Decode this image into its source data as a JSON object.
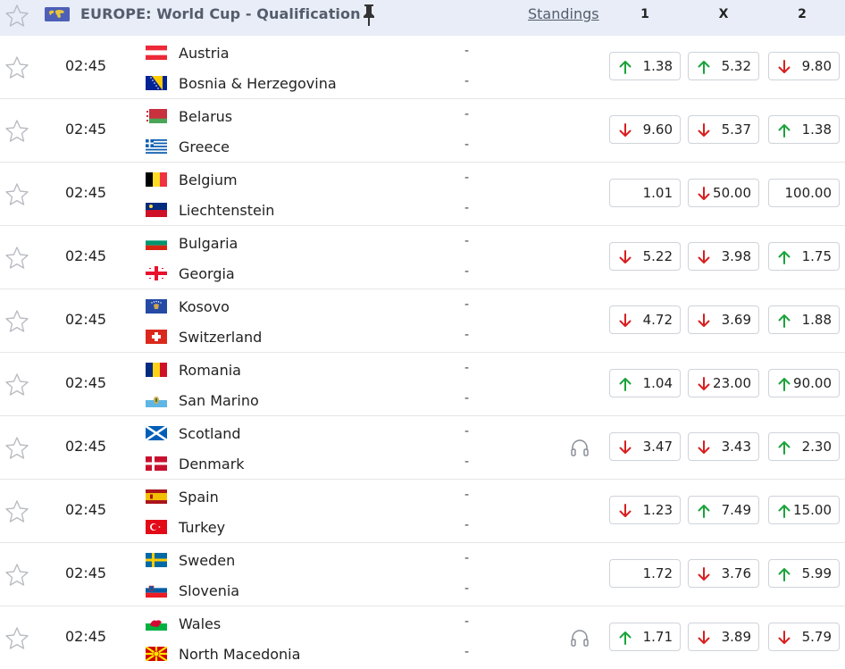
{
  "header": {
    "title": "EUROPE: World Cup - Qualification",
    "standings_label": "Standings",
    "col_1": "1",
    "col_x": "X",
    "col_2": "2"
  },
  "colors": {
    "up": "#1aa33a",
    "down": "#d81f1f",
    "header_bg": "#e8edf7"
  },
  "matches": [
    {
      "time": "02:45",
      "home": "Austria",
      "away": "Bosnia & Herzegovina",
      "home_score": "-",
      "away_score": "-",
      "audio": false,
      "odds": [
        {
          "value": "1.38",
          "dir": "up"
        },
        {
          "value": "5.32",
          "dir": "up"
        },
        {
          "value": "9.80",
          "dir": "down"
        }
      ]
    },
    {
      "time": "02:45",
      "home": "Belarus",
      "away": "Greece",
      "home_score": "-",
      "away_score": "-",
      "audio": false,
      "odds": [
        {
          "value": "9.60",
          "dir": "down"
        },
        {
          "value": "5.37",
          "dir": "down"
        },
        {
          "value": "1.38",
          "dir": "up"
        }
      ]
    },
    {
      "time": "02:45",
      "home": "Belgium",
      "away": "Liechtenstein",
      "home_score": "-",
      "away_score": "-",
      "audio": false,
      "odds": [
        {
          "value": "1.01",
          "dir": "none"
        },
        {
          "value": "50.00",
          "dir": "down"
        },
        {
          "value": "100.00",
          "dir": "none"
        }
      ]
    },
    {
      "time": "02:45",
      "home": "Bulgaria",
      "away": "Georgia",
      "home_score": "-",
      "away_score": "-",
      "audio": false,
      "odds": [
        {
          "value": "5.22",
          "dir": "down"
        },
        {
          "value": "3.98",
          "dir": "down"
        },
        {
          "value": "1.75",
          "dir": "up"
        }
      ]
    },
    {
      "time": "02:45",
      "home": "Kosovo",
      "away": "Switzerland",
      "home_score": "-",
      "away_score": "-",
      "audio": false,
      "odds": [
        {
          "value": "4.72",
          "dir": "down"
        },
        {
          "value": "3.69",
          "dir": "down"
        },
        {
          "value": "1.88",
          "dir": "up"
        }
      ]
    },
    {
      "time": "02:45",
      "home": "Romania",
      "away": "San Marino",
      "home_score": "-",
      "away_score": "-",
      "audio": false,
      "odds": [
        {
          "value": "1.04",
          "dir": "up"
        },
        {
          "value": "23.00",
          "dir": "down"
        },
        {
          "value": "90.00",
          "dir": "up"
        }
      ]
    },
    {
      "time": "02:45",
      "home": "Scotland",
      "away": "Denmark",
      "home_score": "-",
      "away_score": "-",
      "audio": true,
      "odds": [
        {
          "value": "3.47",
          "dir": "down"
        },
        {
          "value": "3.43",
          "dir": "down"
        },
        {
          "value": "2.30",
          "dir": "up"
        }
      ]
    },
    {
      "time": "02:45",
      "home": "Spain",
      "away": "Turkey",
      "home_score": "-",
      "away_score": "-",
      "audio": false,
      "odds": [
        {
          "value": "1.23",
          "dir": "down"
        },
        {
          "value": "7.49",
          "dir": "up"
        },
        {
          "value": "15.00",
          "dir": "up"
        }
      ]
    },
    {
      "time": "02:45",
      "home": "Sweden",
      "away": "Slovenia",
      "home_score": "-",
      "away_score": "-",
      "audio": false,
      "odds": [
        {
          "value": "1.72",
          "dir": "none"
        },
        {
          "value": "3.76",
          "dir": "down"
        },
        {
          "value": "5.99",
          "dir": "up"
        }
      ]
    },
    {
      "time": "02:45",
      "home": "Wales",
      "away": "North Macedonia",
      "home_score": "-",
      "away_score": "-",
      "audio": true,
      "odds": [
        {
          "value": "1.71",
          "dir": "up"
        },
        {
          "value": "3.89",
          "dir": "down"
        },
        {
          "value": "5.79",
          "dir": "down"
        }
      ]
    }
  ]
}
